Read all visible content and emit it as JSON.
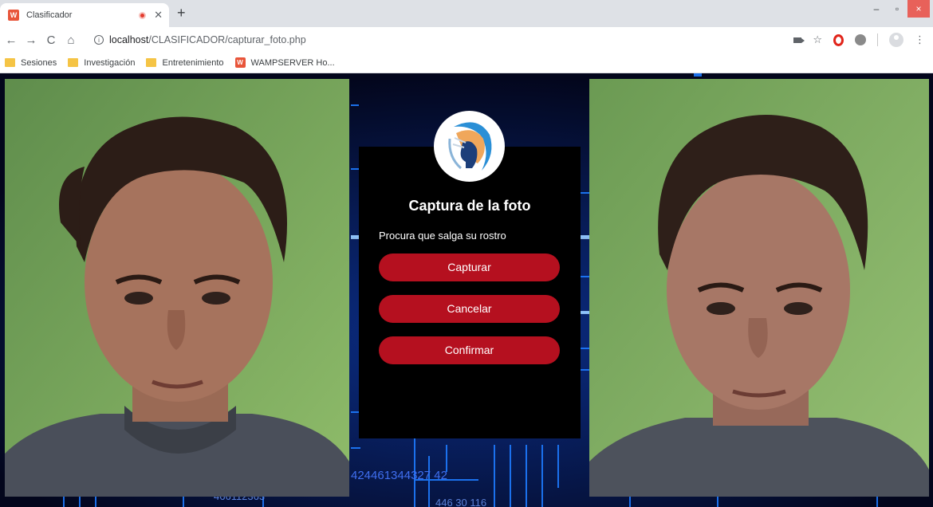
{
  "tab": {
    "title": "Clasificador",
    "favicon": "wampserver-icon",
    "recording_indicator": "recording-dot-icon"
  },
  "window_controls": {
    "minimize": "–",
    "maximize": "▫",
    "close": "×"
  },
  "toolbar": {
    "back": "←",
    "forward": "→",
    "reload": "C",
    "home": "⌂",
    "url_host": "localhost",
    "url_path": "/CLASIFICADOR/capturar_foto.php",
    "star": "☆"
  },
  "bookmarks": [
    {
      "label": "Sesiones",
      "icon": "folder-icon"
    },
    {
      "label": "Investigación",
      "icon": "folder-icon"
    },
    {
      "label": "Entretenimiento",
      "icon": "folder-icon"
    },
    {
      "label": "WAMPSERVER Ho...",
      "icon": "wampserver-icon"
    }
  ],
  "card": {
    "title": "Captura de la foto",
    "hint": "Procura que salga su rostro",
    "buttons": {
      "capture": "Capturar",
      "cancel": "Cancelar",
      "confirm": "Confirmar"
    }
  },
  "background_text": {
    "code1": "424461344327 42",
    "code2": "466112363",
    "code3": "446 30 116"
  },
  "colors": {
    "button_bg": "#b5101f",
    "card_bg": "#000000",
    "page_bg": "#050a2a",
    "circuit_blue": "#1e7bff"
  }
}
